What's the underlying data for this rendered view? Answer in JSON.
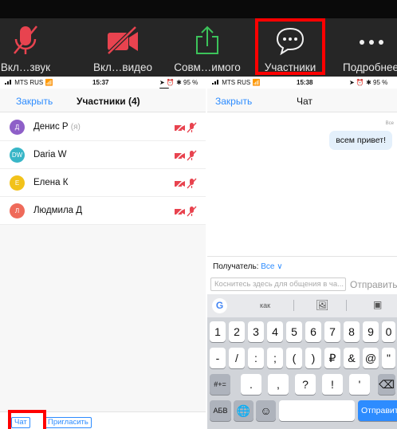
{
  "toolbar": {
    "items": [
      {
        "label": "Вкл…звук",
        "icon": "microphone-muted-icon"
      },
      {
        "label": "Вкл…видео",
        "icon": "video-camera-muted-icon"
      },
      {
        "label": "Совм…имого",
        "icon": "share-screen-icon"
      },
      {
        "label": "Участники",
        "icon": "chat-bubble-icon"
      },
      {
        "label": "Подробнее",
        "icon": "more-icon"
      }
    ],
    "colors": {
      "muted": "#e8434f",
      "share": "#3cc35a",
      "highlight": "#ff0000"
    }
  },
  "left_screen": {
    "status": {
      "carrier": "MTS RUS",
      "time": "15:37",
      "battery": "95 %"
    },
    "close_label": "Закрыть",
    "title": "Участники (4)",
    "participants": [
      {
        "initials": "Д",
        "name": "Денис Р",
        "me_tag": "(я)",
        "color": "#8e5fc8"
      },
      {
        "initials": "DW",
        "name": "Daria W",
        "me_tag": "",
        "color": "#38b6c7"
      },
      {
        "initials": "Е",
        "name": "Елена К",
        "me_tag": "",
        "color": "#f2c21a"
      },
      {
        "initials": "Л",
        "name": "Людмила Д",
        "me_tag": "",
        "color": "#ef6a5a"
      }
    ],
    "bottom": {
      "chat_label": "Чат",
      "invite_label": "Пригласить"
    }
  },
  "right_screen": {
    "status": {
      "carrier": "MTS RUS",
      "time": "15:38",
      "battery": "95 %"
    },
    "close_label": "Закрыть",
    "title": "Чат",
    "messages": [
      {
        "sender": "Все",
        "text": "всем привет!"
      }
    ],
    "recipient_label": "Получатель:",
    "recipient_value": "Все",
    "input_placeholder": "Коснитесь здесь для общения в ча...",
    "send_label": "Отправить",
    "keyboard": {
      "suggestions": [
        "как"
      ],
      "row1": [
        "1",
        "2",
        "3",
        "4",
        "5",
        "6",
        "7",
        "8",
        "9",
        "0"
      ],
      "row2": [
        "-",
        "/",
        ":",
        ";",
        "(",
        ")",
        "₽",
        "&",
        "@",
        "\""
      ],
      "row3_mode": "#+=",
      "row3": [
        ".",
        ",",
        "?",
        "!",
        "'"
      ],
      "row4_abc": "АБВ",
      "row4_send": "Отправить"
    }
  }
}
